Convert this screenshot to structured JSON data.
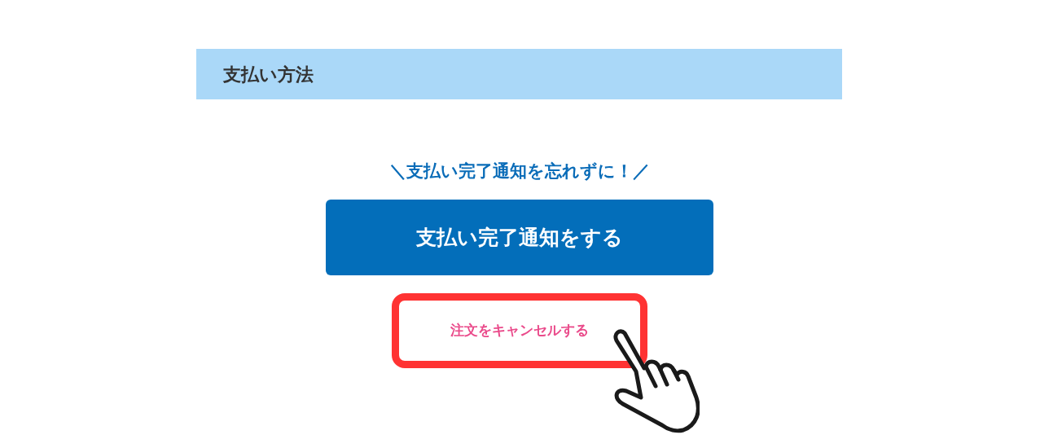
{
  "section": {
    "title": "支払い方法"
  },
  "tagline": "＼支払い完了通知を忘れずに！／",
  "primary_button": {
    "label": "支払い完了通知をする"
  },
  "cancel_link": {
    "label": "注文をキャンセルする",
    "highlighted": true
  }
}
